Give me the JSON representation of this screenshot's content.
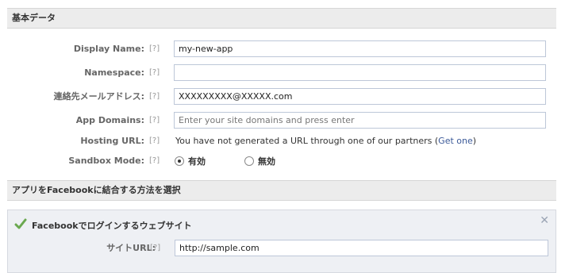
{
  "basic": {
    "header": "基本データ",
    "help": "[?]",
    "display_name": {
      "label": "Display Name:",
      "value": "my-new-app"
    },
    "namespace": {
      "label": "Namespace:",
      "value": ""
    },
    "contact_email": {
      "label": "連絡先メールアドレス:",
      "value": "XXXXXXXXX@XXXXX.com"
    },
    "app_domains": {
      "label": "App Domains:",
      "placeholder": "Enter your site domains and press enter"
    },
    "hosting_url": {
      "label": "Hosting URL:",
      "text": "You have not generated a URL through one of our partners (",
      "link": "Get one",
      "suffix": ")"
    },
    "sandbox": {
      "label": "Sandbox Mode:",
      "option_on": "有効",
      "option_off": "無効",
      "selected": "有効"
    }
  },
  "integration": {
    "header": "アプリをFacebookに結合する方法を選択",
    "panel": {
      "title": "Facebookでログインするウェブサイト",
      "site_url": {
        "label": "サイトURL:",
        "value": "http://sample.com"
      }
    }
  },
  "colors": {
    "link": "#3b5998",
    "check": "#6aa84f"
  },
  "icons": [
    "check-icon",
    "close-icon"
  ]
}
